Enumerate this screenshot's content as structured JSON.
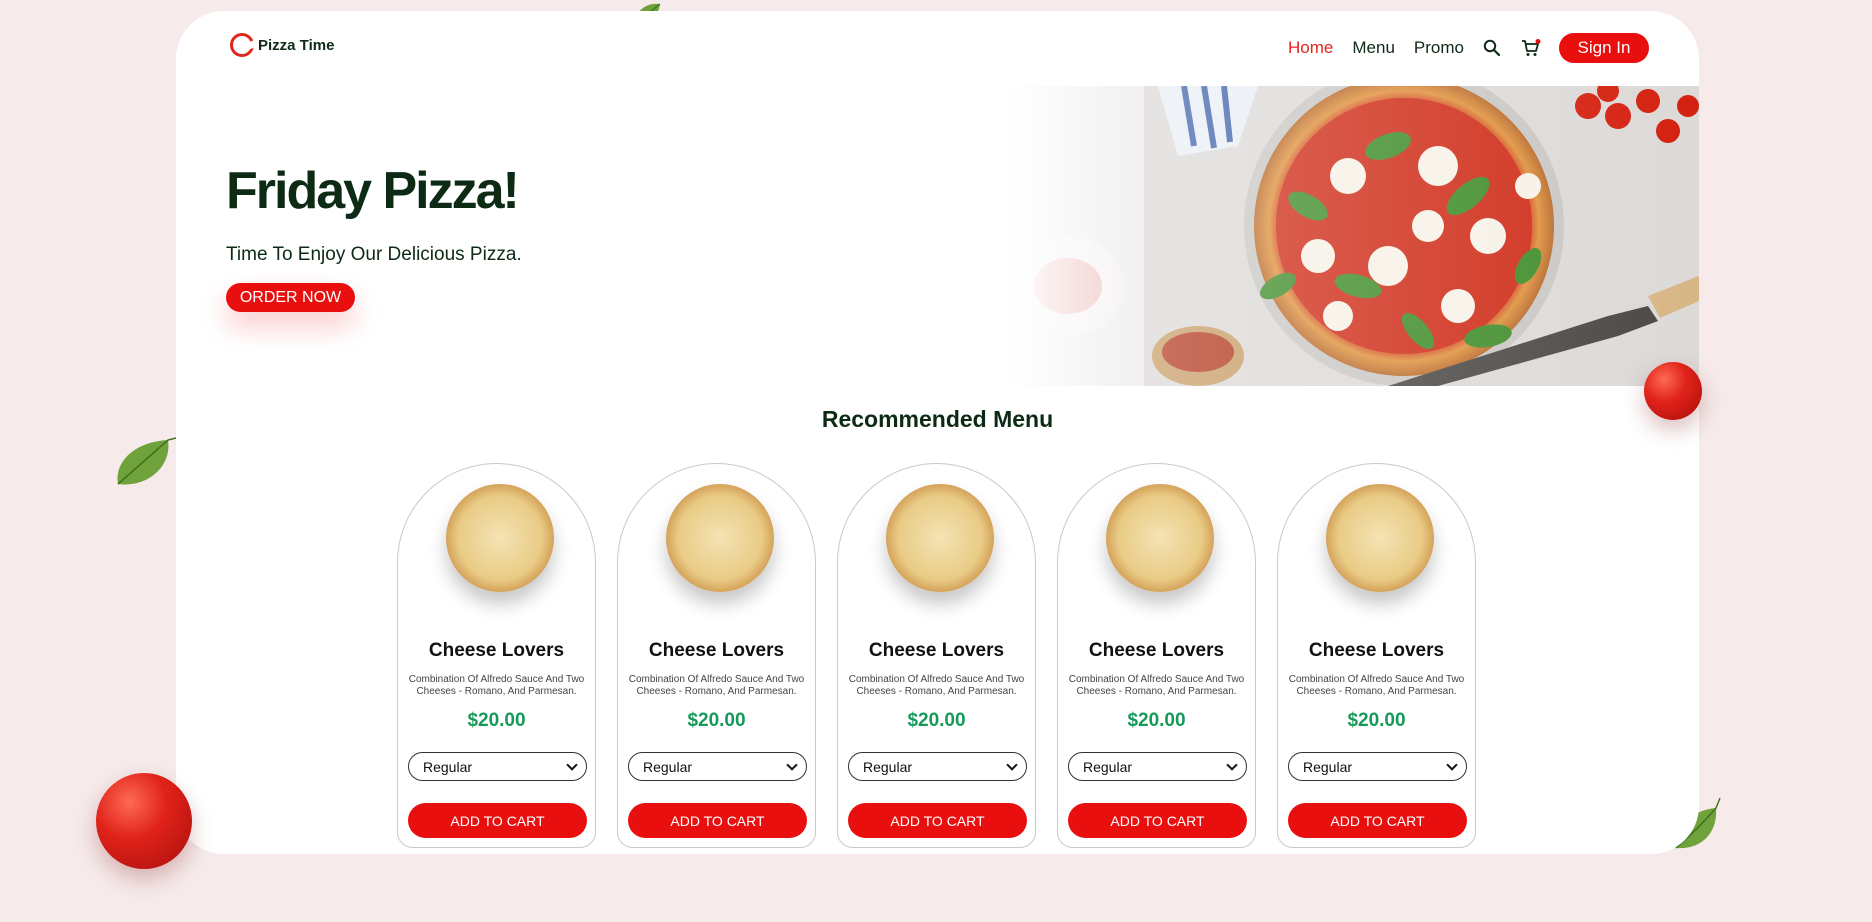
{
  "brand": {
    "name": "Pizza Time",
    "accent": "#ea0f0f",
    "price_color": "#169a5a"
  },
  "nav": {
    "links": [
      {
        "label": "Home",
        "active": true
      },
      {
        "label": "Menu",
        "active": false
      },
      {
        "label": "Promo",
        "active": false
      }
    ],
    "search_icon": "search-icon",
    "cart_icon": "cart-icon",
    "signin_label": "Sign In"
  },
  "hero": {
    "title": "Friday Pizza!",
    "subtitle": "Time To Enjoy Our Delicious Pizza.",
    "cta_label": "ORDER NOW"
  },
  "recommended": {
    "title": "Recommended Menu",
    "items": [
      {
        "name": "Cheese Lovers",
        "description": "Combination Of Alfredo Sauce And Two Cheeses - Romano, And Parmesan.",
        "price": "$20.00",
        "size": "Regular",
        "cta": "ADD TO CART"
      },
      {
        "name": "Cheese Lovers",
        "description": "Combination Of Alfredo Sauce And Two Cheeses - Romano, And Parmesan.",
        "price": "$20.00",
        "size": "Regular",
        "cta": "ADD TO CART"
      },
      {
        "name": "Cheese Lovers",
        "description": "Combination Of Alfredo Sauce And Two Cheeses - Romano, And Parmesan.",
        "price": "$20.00",
        "size": "Regular",
        "cta": "ADD TO CART"
      },
      {
        "name": "Cheese Lovers",
        "description": "Combination Of Alfredo Sauce And Two Cheeses - Romano, And Parmesan.",
        "price": "$20.00",
        "size": "Regular",
        "cta": "ADD TO CART"
      },
      {
        "name": "Cheese Lovers",
        "description": "Combination Of Alfredo Sauce And Two Cheeses - Romano, And Parmesan.",
        "price": "$20.00",
        "size": "Regular",
        "cta": "ADD TO CART"
      }
    ]
  }
}
